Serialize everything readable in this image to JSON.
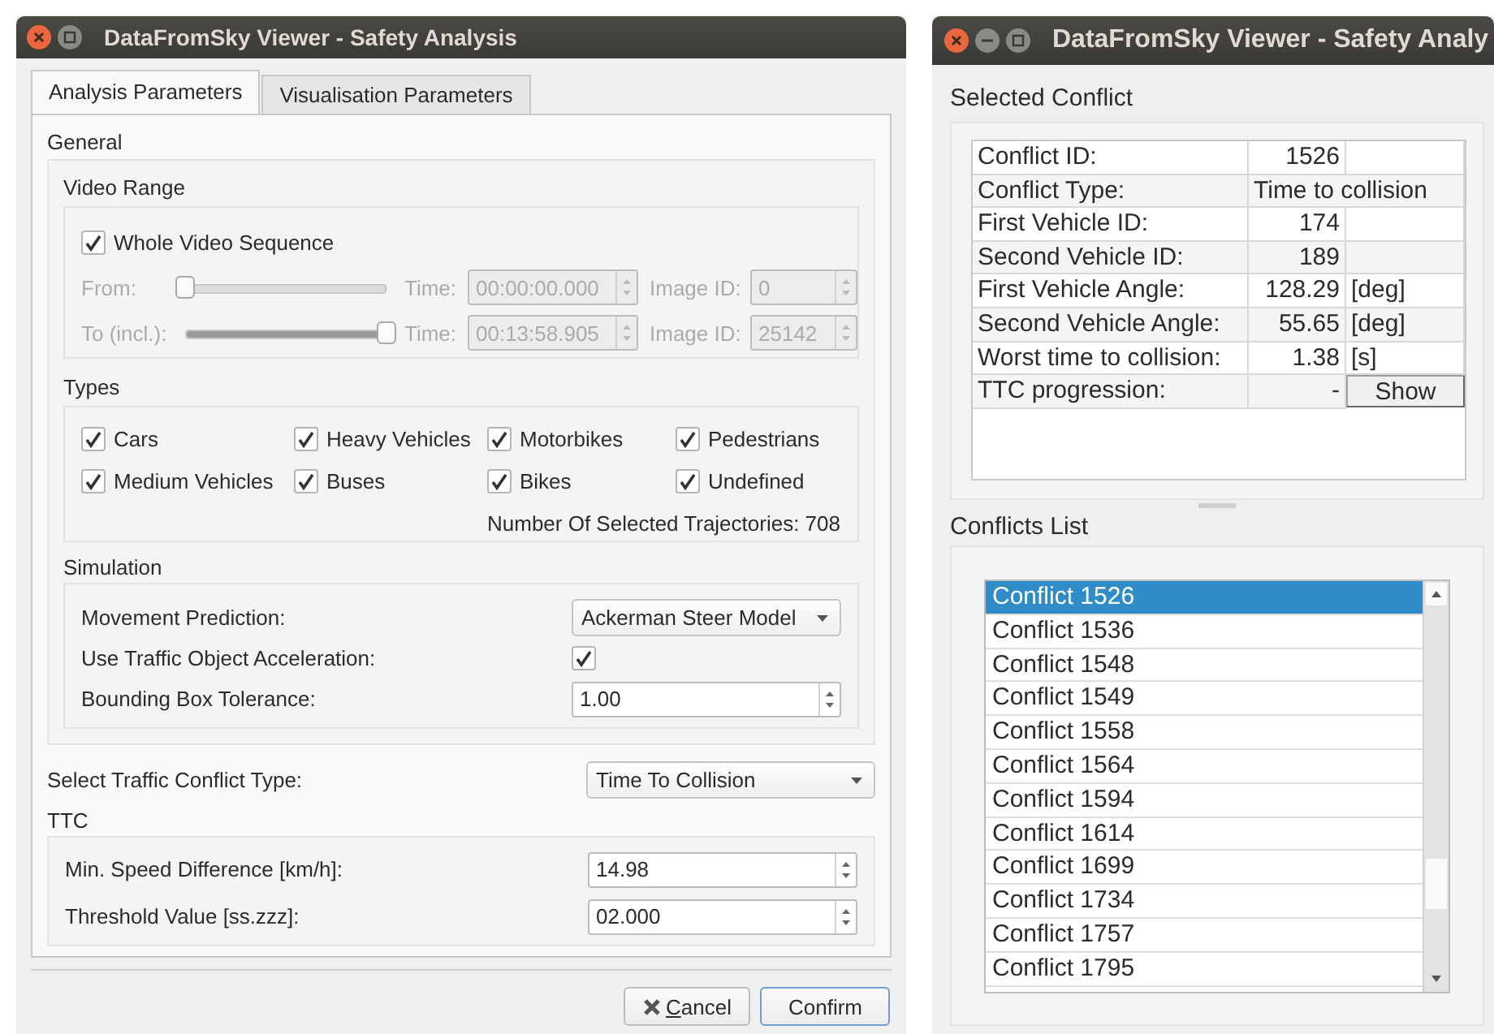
{
  "left_window": {
    "title": "DataFromSky Viewer - Safety Analysis",
    "tabs": [
      {
        "label": "Analysis Parameters",
        "selected": true
      },
      {
        "label": "Visualisation Parameters",
        "selected": false
      }
    ],
    "general": {
      "title": "General",
      "video_range": {
        "title": "Video Range",
        "whole_sequence": {
          "label": "Whole Video Sequence",
          "checked": true
        },
        "rows": [
          {
            "label": "From:",
            "level": 0,
            "time_label": "Time:",
            "time": "00:00:00.000",
            "image_label": "Image ID:",
            "image_id": "0",
            "disabled": true
          },
          {
            "label": "To (incl.):",
            "level": 1,
            "time_label": "Time:",
            "time": "00:13:58.905",
            "image_label": "Image ID:",
            "image_id": "25142",
            "disabled": true
          }
        ]
      },
      "types": {
        "title": "Types",
        "items": [
          {
            "label": "Cars",
            "checked": true
          },
          {
            "label": "Heavy Vehicles",
            "checked": true
          },
          {
            "label": "Motorbikes",
            "checked": true
          },
          {
            "label": "Pedestrians",
            "checked": true
          },
          {
            "label": "Medium Vehicles",
            "checked": true
          },
          {
            "label": "Buses",
            "checked": true
          },
          {
            "label": "Bikes",
            "checked": true
          },
          {
            "label": "Undefined",
            "checked": true
          }
        ],
        "count_text": "Number Of Selected Trajectories: 708"
      },
      "simulation": {
        "title": "Simulation",
        "rows": [
          {
            "kind": "dropdown",
            "label": "Movement Prediction:",
            "value": "Ackerman Steer Model"
          },
          {
            "kind": "checkbox",
            "label": "Use Traffic Object Acceleration:",
            "checked": true
          },
          {
            "kind": "spin",
            "label": "Bounding Box Tolerance:",
            "value": "1.00"
          }
        ]
      }
    },
    "conflict_type": {
      "label": "Select Traffic Conflict Type:",
      "value": "Time To Collision"
    },
    "ttc": {
      "title": "TTC",
      "rows": [
        {
          "kind": "spin",
          "label": "Min. Speed Difference [km/h]:",
          "value": "14.98"
        },
        {
          "kind": "spin",
          "label": "Threshold Value [ss.zzz]:",
          "value": "02.000"
        }
      ]
    },
    "buttons": [
      {
        "kind": "cancel",
        "label": "Cancel",
        "mnemonic": true
      },
      {
        "kind": "default",
        "label": "Confirm",
        "mnemonic": false
      }
    ]
  },
  "right_window": {
    "title": "DataFromSky Viewer - Safety Analy",
    "selected_conflict": {
      "title": "Selected Conflict",
      "rows": [
        {
          "kind": "value",
          "label": "Conflict ID:",
          "value": "1526"
        },
        {
          "kind": "wide",
          "label": "Conflict Type:",
          "value": "Time to collision"
        },
        {
          "kind": "value",
          "label": "First Vehicle ID:",
          "value": "174"
        },
        {
          "kind": "value",
          "label": "Second Vehicle ID:",
          "value": "189"
        },
        {
          "kind": "value",
          "label": "First Vehicle Angle:",
          "value": "128.29",
          "unit": "[deg]"
        },
        {
          "kind": "value",
          "label": "Second Vehicle Angle:",
          "value": "55.65",
          "unit": "[deg]"
        },
        {
          "kind": "value",
          "label": "Worst time to collision:",
          "value": "1.38",
          "unit": "[s]"
        },
        {
          "kind": "button",
          "label": "TTC progression:",
          "value": "-",
          "button": "Show"
        }
      ]
    },
    "conflicts_list": {
      "title": "Conflicts List",
      "items": [
        {
          "label": "Conflict 1526",
          "selected": true
        },
        {
          "label": "Conflict 1536",
          "selected": false
        },
        {
          "label": "Conflict 1548",
          "selected": false
        },
        {
          "label": "Conflict 1549",
          "selected": false
        },
        {
          "label": "Conflict 1558",
          "selected": false
        },
        {
          "label": "Conflict 1564",
          "selected": false
        },
        {
          "label": "Conflict 1594",
          "selected": false
        },
        {
          "label": "Conflict 1614",
          "selected": false
        },
        {
          "label": "Conflict 1699",
          "selected": false
        },
        {
          "label": "Conflict 1734",
          "selected": false
        },
        {
          "label": "Conflict 1757",
          "selected": false
        },
        {
          "label": "Conflict 1795",
          "selected": false
        }
      ]
    }
  }
}
